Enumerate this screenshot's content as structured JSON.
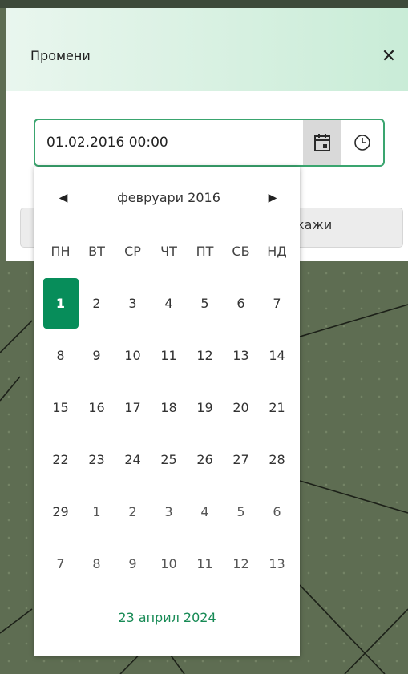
{
  "dialog": {
    "title": "Промени",
    "close_symbol": "✕",
    "background_button_label": "кажи"
  },
  "datetime_input": {
    "value": "01.02.2016 00:00",
    "calendar_icon": "calendar-icon",
    "clock_icon": "clock-icon"
  },
  "datepicker": {
    "prev_symbol": "◀",
    "next_symbol": "▶",
    "month_label": "февруари 2016",
    "weekdays": [
      "ПН",
      "ВТ",
      "СР",
      "ЧТ",
      "ПТ",
      "СБ",
      "НД"
    ],
    "weeks": [
      [
        "1",
        "2",
        "3",
        "4",
        "5",
        "6",
        "7"
      ],
      [
        "8",
        "9",
        "10",
        "11",
        "12",
        "13",
        "14"
      ],
      [
        "15",
        "16",
        "17",
        "18",
        "19",
        "20",
        "21"
      ],
      [
        "22",
        "23",
        "24",
        "25",
        "26",
        "27",
        "28"
      ],
      [
        "29",
        "1",
        "2",
        "3",
        "4",
        "5",
        "6"
      ],
      [
        "7",
        "8",
        "9",
        "10",
        "11",
        "12",
        "13"
      ]
    ],
    "selected_day": "1",
    "today_label": "23 април 2024"
  },
  "colors": {
    "accent": "#078d5a",
    "input_border": "#3aa56f",
    "today_link": "#178a55",
    "header_gradient_start": "#e9f6ee",
    "header_gradient_end": "#c9ecd7",
    "map_background": "#5e6d52"
  }
}
